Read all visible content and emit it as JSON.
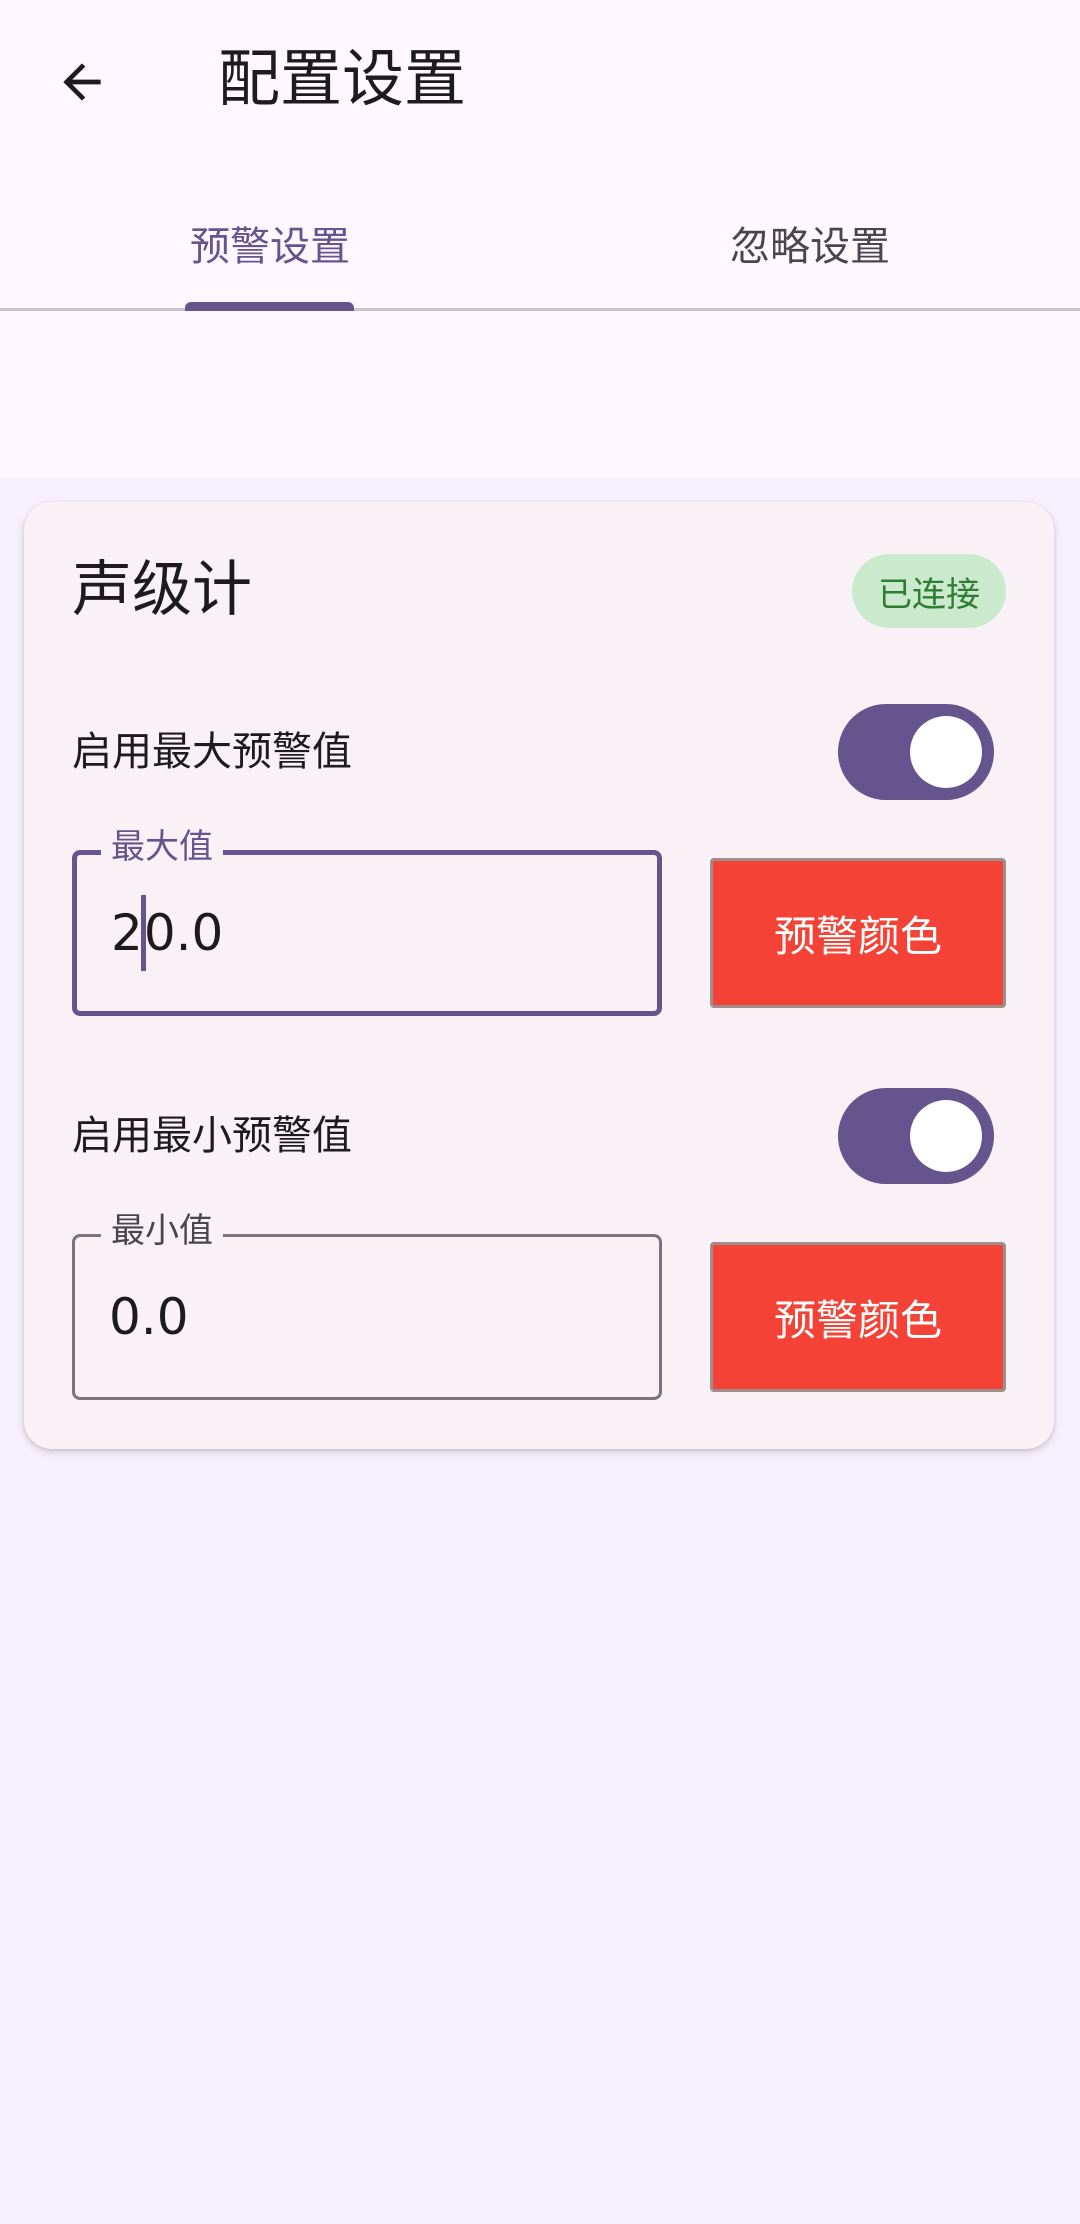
{
  "header": {
    "title": "配置设置"
  },
  "tabs": [
    {
      "label": "预警设置",
      "selected": true
    },
    {
      "label": "忽略设置",
      "selected": false
    }
  ],
  "device": {
    "name": "声级计",
    "status": "已连接",
    "status_color": "#2e7d32",
    "status_bg": "#cbe9cd"
  },
  "max_alert": {
    "toggle_label": "启用最大预警值",
    "enabled": true,
    "field_label": "最大值",
    "value_before_cursor": "2",
    "value_after_cursor": "0.0",
    "color_button_label": "预警颜色",
    "alert_color": "#f44336"
  },
  "min_alert": {
    "toggle_label": "启用最小预警值",
    "enabled": true,
    "field_label": "最小值",
    "value": "0.0",
    "color_button_label": "预警颜色",
    "alert_color": "#f44336"
  },
  "theme": {
    "accent": "#65558f",
    "background": "#f5f0fb",
    "top_surface": "#fef7fe"
  },
  "icons": {
    "back": "arrow-left"
  }
}
